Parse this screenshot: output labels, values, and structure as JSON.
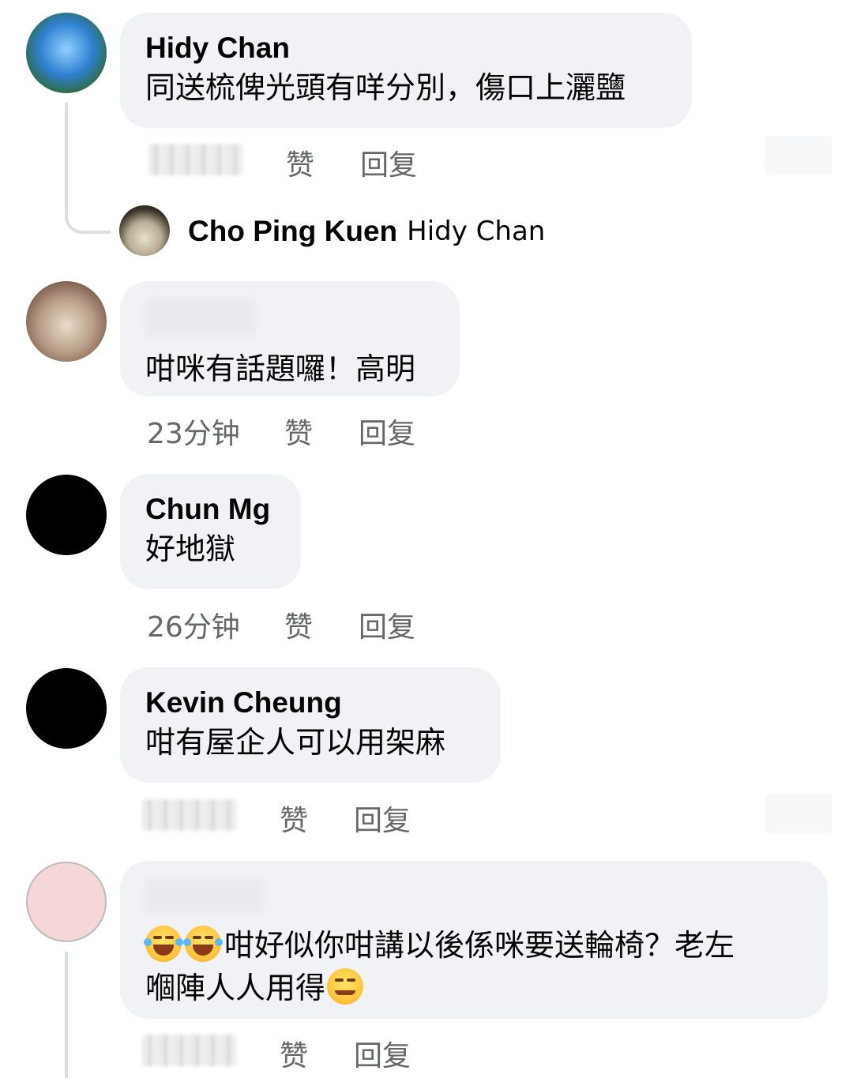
{
  "comments": [
    {
      "name": "Hidy Chan",
      "text": "同送梳俾光頭有咩分別，傷口上灑鹽",
      "time": "",
      "like": "赞",
      "reply": "回复",
      "avatar_icon": "graduate-photo"
    },
    {
      "name": "",
      "text": "咁咪有話題囉！高明",
      "time": "23分钟",
      "like": "赞",
      "reply": "回复",
      "avatar_icon": "family-dinner-photo"
    },
    {
      "name": "Chun Mg",
      "text": "好地獄",
      "time": "26分钟",
      "like": "赞",
      "reply": "回复",
      "avatar_icon": "black-avatar"
    },
    {
      "name": "Kevin Cheung",
      "text": "咁有屋企人可以用架麻",
      "time": "",
      "like": "赞",
      "reply": "回复",
      "avatar_icon": "black-avatar"
    },
    {
      "name": "",
      "text_line1": "咁好似你咁講以後係咪要送輪椅？老左",
      "text_line2": "嗰陣人人用得",
      "time": "",
      "like": "赞",
      "reply": "回复",
      "avatar_icon": "anime-girl-avatar"
    }
  ],
  "reply_preview": {
    "name": "Cho Ping Kuen",
    "tag": "Hidy Chan",
    "avatar_icon": "cat-avatar"
  },
  "colors": {
    "bubble": "#f0f2f5",
    "meta_text": "#65676b",
    "thread_line": "#dadde1"
  }
}
